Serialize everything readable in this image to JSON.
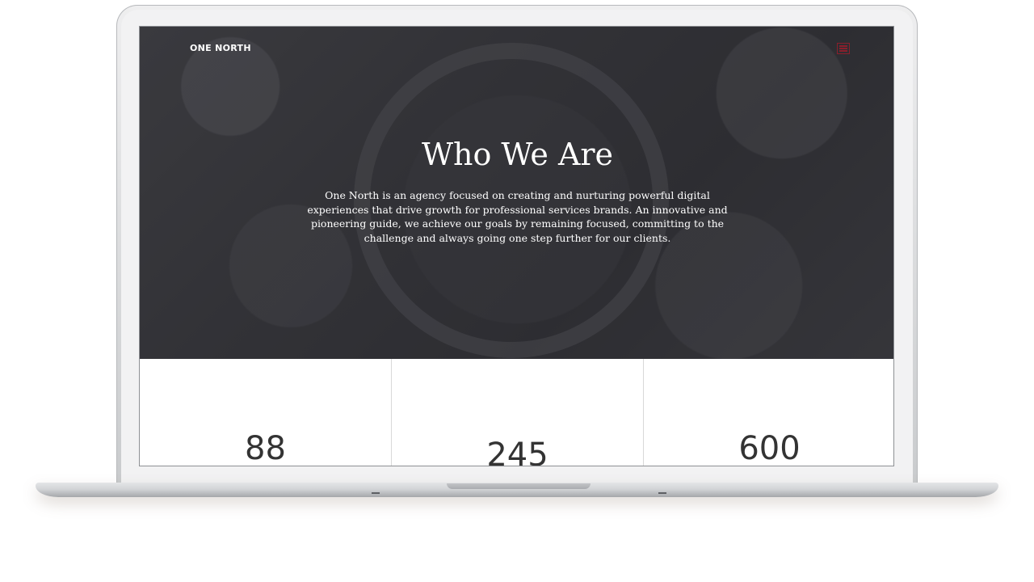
{
  "header": {
    "brand": "ONE NORTH",
    "menu_icon": "hamburger-menu-icon",
    "menu_color": "#8a1f2c"
  },
  "hero": {
    "title": "Who We Are",
    "description": "One North is an agency focused on creating and nurturing powerful digital experiences that drive growth for professional services brands. An innovative and pioneering guide, we achieve our goals by remaining focused, committing to the challenge and always going one step further for our clients."
  },
  "stats": [
    {
      "value": "88"
    },
    {
      "value": "245"
    },
    {
      "value": "600"
    }
  ]
}
